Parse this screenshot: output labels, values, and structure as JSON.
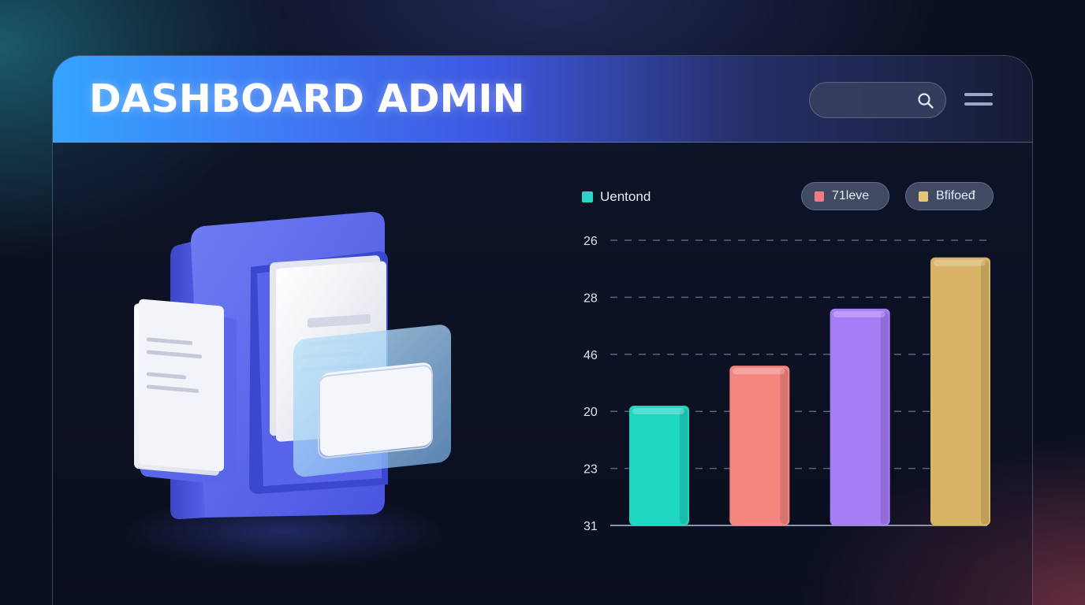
{
  "header": {
    "title": "DASHBOARD ADMIN",
    "search_placeholder": ""
  },
  "icons": {
    "search": "search-icon",
    "menu": "hamburger-menu-icon",
    "illustration": "file-cabinet-documents-icon"
  },
  "legend": {
    "main": {
      "label": "Uentond",
      "color": "#2bd4c6"
    },
    "pill_1": {
      "label": "71leve",
      "color": "#f47b84"
    },
    "pill_2": {
      "label": "Bfifoeđ",
      "color": "#e6c77a"
    }
  },
  "colors": {
    "accent_blue": "#3f7df5",
    "background": "#0b1020"
  },
  "chart_data": {
    "type": "bar",
    "y_tick_labels": [
      "26",
      "28",
      "46",
      "20",
      "23",
      "31"
    ],
    "categories": [
      "",
      "",
      "",
      ""
    ],
    "values": [
      2.1,
      2.8,
      3.8,
      4.7
    ],
    "ylim": [
      0,
      5
    ],
    "bar_colors": [
      "#1fd6c3",
      "#f4867f",
      "#a77cf7",
      "#d9b466"
    ],
    "grid": true
  }
}
